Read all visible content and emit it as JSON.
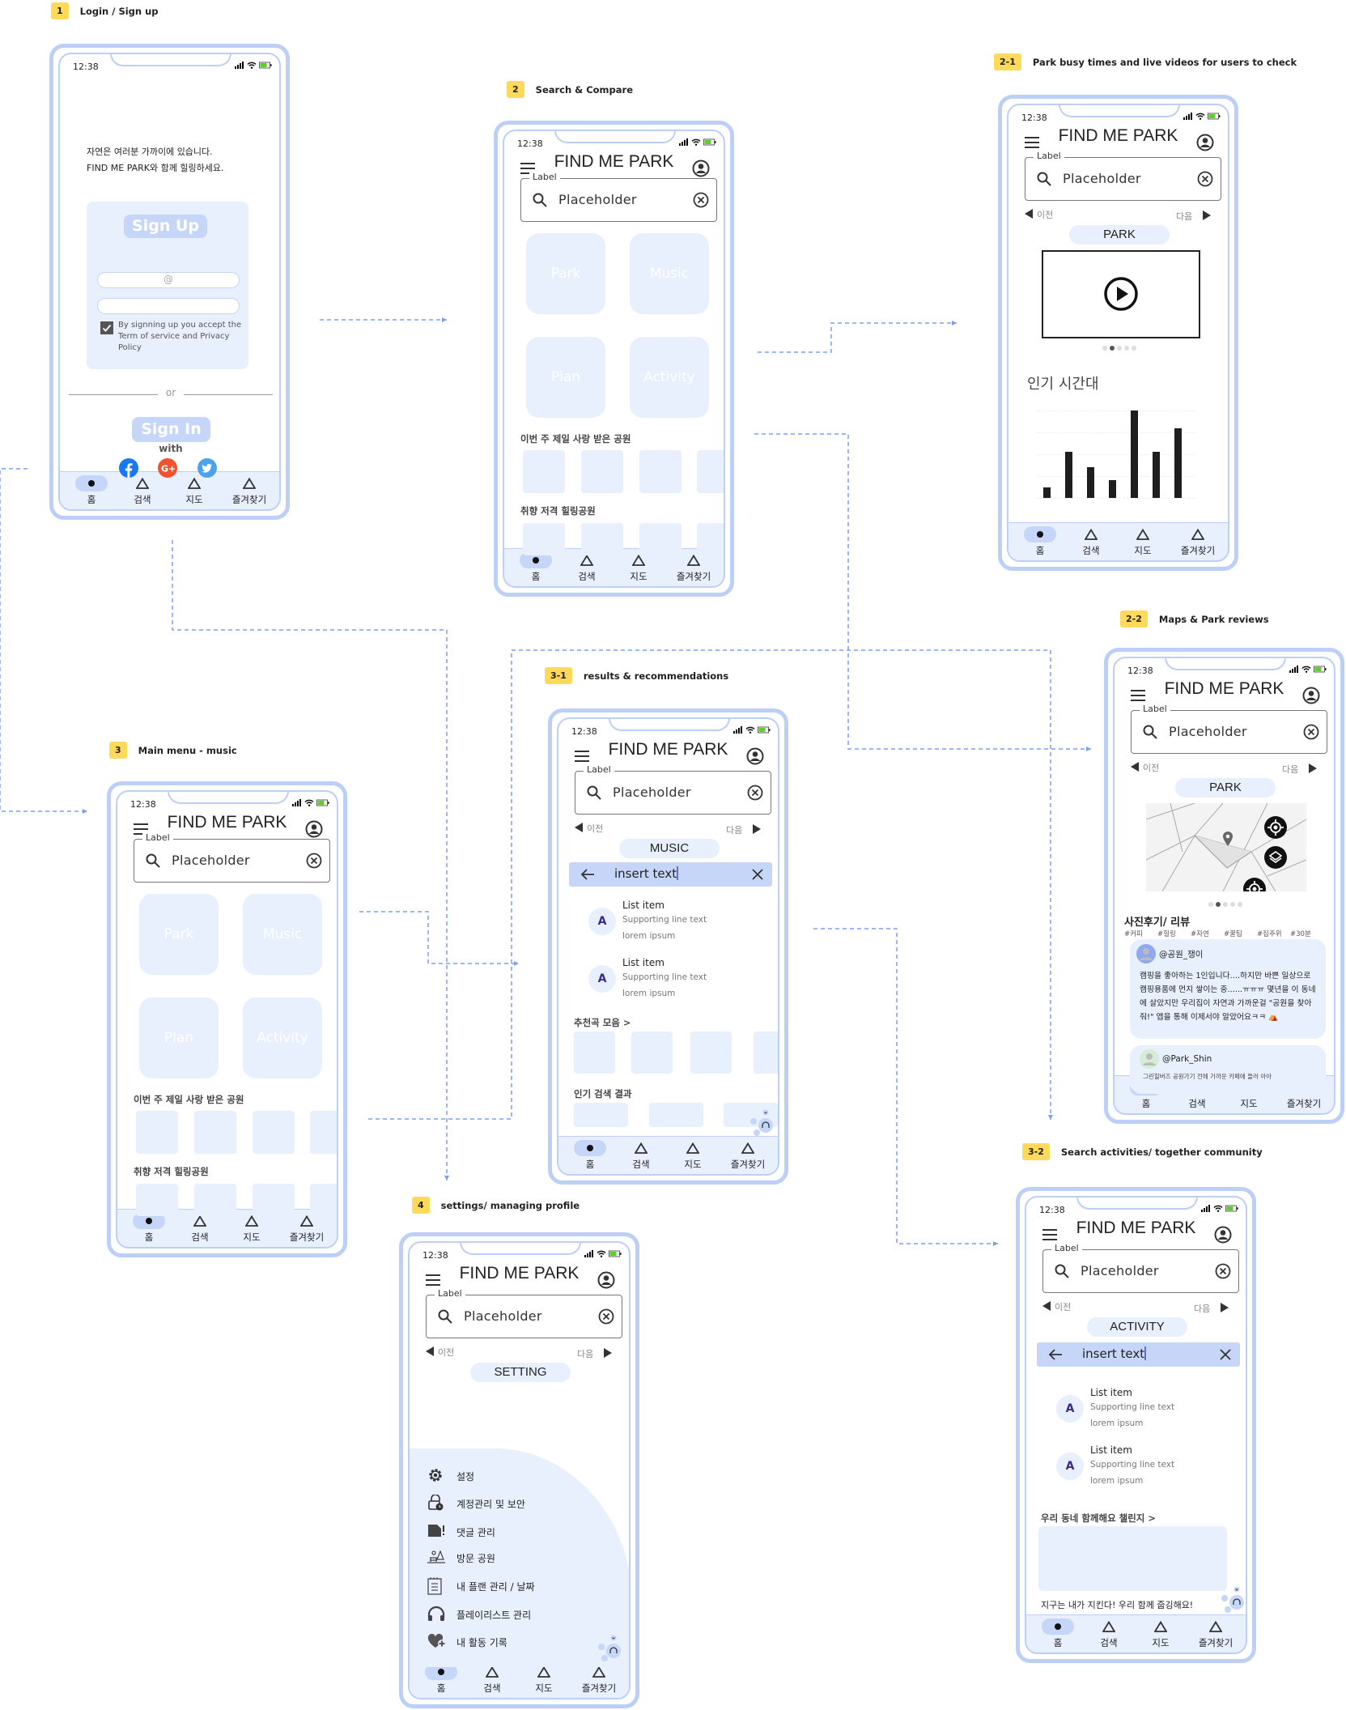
{
  "sections": {
    "login": {
      "badge": "1",
      "title": "Login / Sign up"
    },
    "search": {
      "badge": "2",
      "title": "Search & Compare"
    },
    "park_live": {
      "badge": "2-1",
      "title": "Park busy times and live videos for users to check"
    },
    "park_map": {
      "badge": "2-2",
      "title": "Maps & Park reviews"
    },
    "music": {
      "badge": "3-1",
      "title": "results & recommendations"
    },
    "main_music": {
      "badge": "3",
      "title": "Main menu - music"
    },
    "settings": {
      "badge": "4",
      "title": "settings/ managing profile"
    },
    "activity": {
      "badge": "3-2",
      "title": "Search activities/ together community"
    }
  },
  "common": {
    "time": "12:38",
    "app_title": "FIND ME PARK",
    "search_label": "Label",
    "search_placeholder": "Placeholder",
    "prev": "이전",
    "next": "다음",
    "nav": [
      "홈",
      "검색",
      "지도",
      "즐겨찾기"
    ]
  },
  "login": {
    "intro_line1": "자연은 여러분 가까이에 있습니다.",
    "intro_line2": "FIND ME PARK와 함께 힐링하세요.",
    "sign_up": "Sign Up",
    "email_placeholder": "@",
    "terms_checked": true,
    "terms": "By signning up you accept the Term of service and Privacy Policy",
    "or": "or",
    "sign_in": "Sign In",
    "with": "with",
    "social": [
      "facebook-icon",
      "google-plus-icon",
      "twitter-icon"
    ]
  },
  "home": {
    "tiles": [
      "Park",
      "Music",
      "Plan",
      "Activity"
    ],
    "section1": "이번 주 제일 사랑 받은 공원",
    "section2": "취향 저격 힐링공원"
  },
  "park_live": {
    "category": "PARK",
    "popular_times_title": "인기 시간대",
    "carousel_active": 2,
    "carousel_count": 5
  },
  "chart_data": {
    "type": "bar",
    "title": "인기 시간대",
    "values": [
      0.5,
      2.1,
      1.4,
      0.8,
      4.0,
      2.1,
      3.2
    ],
    "ylim": [
      0,
      4
    ],
    "grid": true,
    "bar_color": "#1e1e1e"
  },
  "music": {
    "category": "MUSIC",
    "search_value": "insert text",
    "list": [
      {
        "avatar": "A",
        "title": "List item",
        "line1": "Supporting line text",
        "line2": "lorem ipsum"
      },
      {
        "avatar": "A",
        "title": "List item",
        "line1": "Supporting line text",
        "line2": "lorem ipsum"
      }
    ],
    "rec_title": "추천곡 모음 >",
    "popular_title": "인기 검색 결과"
  },
  "park_map": {
    "category": "PARK",
    "reviews_title": "사진후기/ 리뷰",
    "hashtags": [
      "#커피",
      "#힐링",
      "#자연",
      "#꿀팁",
      "#집주위",
      "#30분"
    ],
    "reviews": [
      {
        "user": "@공원_쟁이",
        "text": "캠핑을 좋아하는 1인입니다....하지만 바쁜 일상으로 캠핑용품에 먼지 쌓이는 중......ㅠㅠㅠ 몇년을 이 동네에 살았지만 우리집이 자연과 가까운걸 \"공원을 찾아줘!\" 앱을 통해 이제서야 알았어요ㅋㅋ ⛺"
      },
      {
        "user": "@Park_Shin",
        "text": "그린힐버즈 공원가기 전에 가까운 카페에 들러 아아"
      }
    ]
  },
  "settings": {
    "category": "SETTING",
    "menu": [
      {
        "icon": "gear-icon",
        "label": "설정"
      },
      {
        "icon": "lock-clock-icon",
        "label": "계정관리 및 보안"
      },
      {
        "icon": "comment-alert-icon",
        "label": "댓글 관리"
      },
      {
        "icon": "park-icon",
        "label": "방문 공원"
      },
      {
        "icon": "notepad-icon",
        "label": "내 플랜 관리 / 날짜"
      },
      {
        "icon": "headphones-icon",
        "label": "플레이리스트 관리"
      },
      {
        "icon": "heart-plus-icon",
        "label": "내 활동 기록"
      }
    ]
  },
  "activity": {
    "category": "ACTIVITY",
    "search_value": "insert text",
    "list": [
      {
        "avatar": "A",
        "title": "List item",
        "line1": "Supporting line text",
        "line2": "lorem ipsum"
      },
      {
        "avatar": "A",
        "title": "List item",
        "line1": "Supporting line text",
        "line2": "lorem ipsum"
      }
    ],
    "challenge_title": "우리 동네 함께해요 챌린지 >",
    "challenge_caption": "지구는 내가 지킨다! 우리 함께 줍깅해요!"
  },
  "colors": {
    "frame": "#bcd0f7",
    "accent_light": "#e8effd",
    "accent": "#c5d6f8",
    "badge": "#ffd95a",
    "connector": "#7d9ef0",
    "battery": "#5ad12a"
  }
}
